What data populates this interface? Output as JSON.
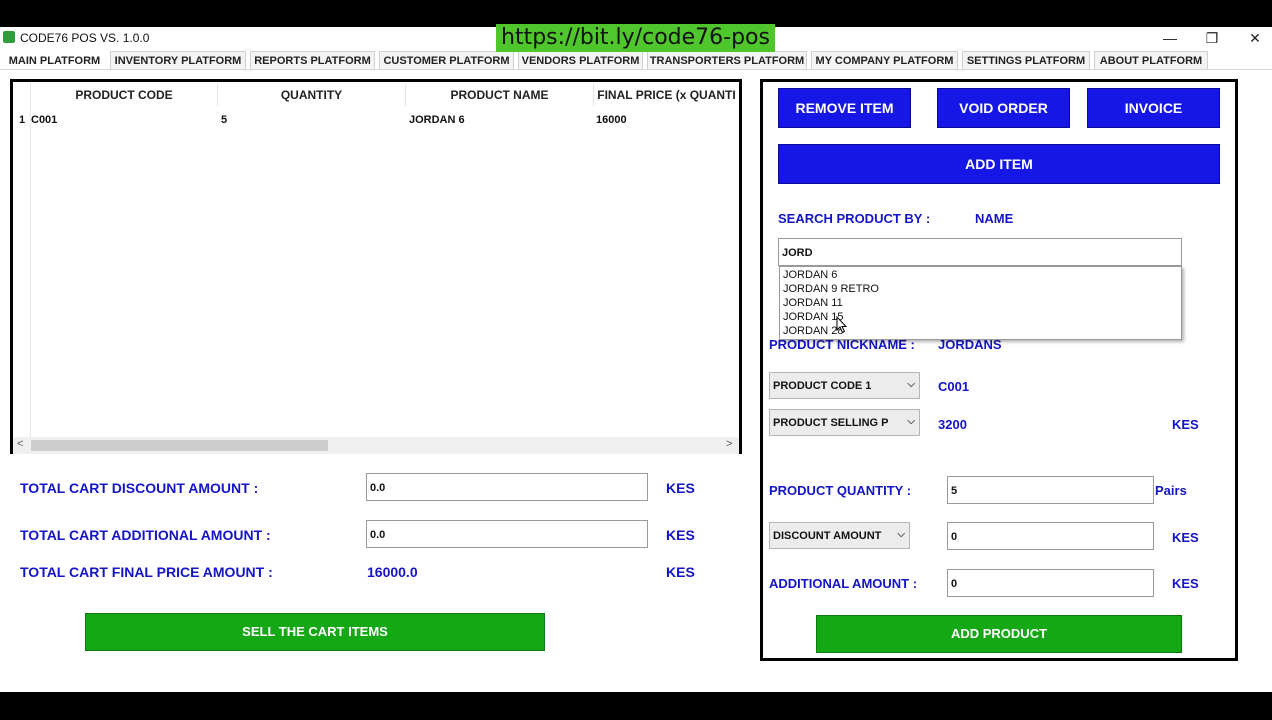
{
  "window": {
    "title": "CODE76 POS VS. 1.0.0",
    "minimize": "—",
    "restore": "❐",
    "close": "✕"
  },
  "banner": {
    "url": "https://bit.ly/code76-pos"
  },
  "tabs": [
    {
      "label": "MAIN PLATFORM"
    },
    {
      "label": "INVENTORY PLATFORM"
    },
    {
      "label": "REPORTS PLATFORM"
    },
    {
      "label": "CUSTOMER PLATFORM"
    },
    {
      "label": "VENDORS PLATFORM"
    },
    {
      "label": "TRANSPORTERS PLATFORM"
    },
    {
      "label": "MY COMPANY PLATFORM"
    },
    {
      "label": "SETTINGS PLATFORM"
    },
    {
      "label": "ABOUT PLATFORM"
    }
  ],
  "cart": {
    "columns": [
      "PRODUCT CODE",
      "QUANTITY",
      "PRODUCT NAME",
      "FINAL PRICE (x QUANTI"
    ],
    "rows": [
      {
        "num": "1",
        "code": "C001",
        "quantity": "5",
        "name": "JORDAN 6",
        "final_price": "16000"
      }
    ],
    "scroll_left": "<",
    "scroll_right": ">"
  },
  "totals": {
    "discount_label": "TOTAL CART  DISCOUNT AMOUNT  :",
    "discount_value": "0.0",
    "discount_currency": "KES",
    "additional_label": "TOTAL CART  ADDITIONAL AMOUNT  :",
    "additional_value": "0.0",
    "additional_currency": "KES",
    "final_label": "TOTAL CART FINAL PRICE AMOUNT  :",
    "final_value": "16000.0",
    "final_currency": "KES",
    "sell_button": "SELL THE CART ITEMS"
  },
  "right": {
    "remove_button": "REMOVE ITEM",
    "void_button": "VOID ORDER",
    "invoice_button": "INVOICE",
    "add_item_button": "ADD ITEM",
    "search_label": "SEARCH PRODUCT BY :",
    "search_mode": "NAME",
    "search_value": "JORD",
    "suggestions": [
      "JORDAN 6",
      "JORDAN 9 RETRO",
      "JORDAN 11",
      "JORDAN 15",
      "JORDAN 28"
    ],
    "nickname_label": "PRODUCT NICKNAME :",
    "nickname_value": "JORDANS",
    "code_combo": "PRODUCT CODE 1",
    "code_value": "C001",
    "price_combo": "PRODUCT SELLING P",
    "price_value": "3200",
    "price_currency": "KES",
    "quantity_label": "PRODUCT QUANTITY :",
    "quantity_value": "5",
    "quantity_unit": "Pairs",
    "discount_combo": "DISCOUNT AMOUNT",
    "discount_value": "0",
    "discount_currency": "KES",
    "additional_label": "ADDITIONAL AMOUNT :",
    "additional_value": "0",
    "additional_currency": "KES",
    "add_product_button": "ADD PRODUCT"
  }
}
